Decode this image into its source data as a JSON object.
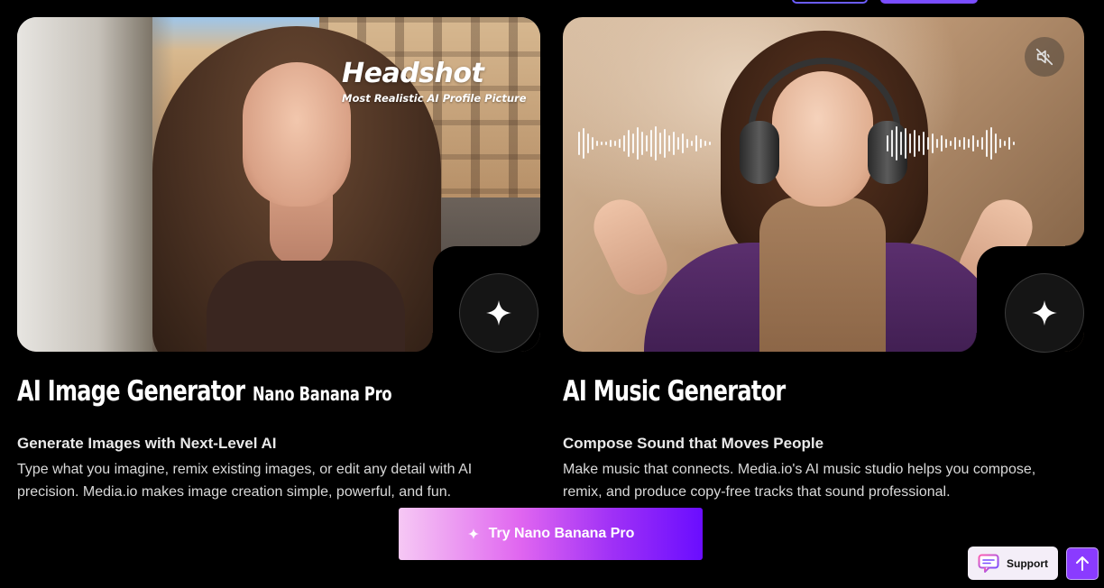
{
  "cards": [
    {
      "overlay_title": "Headshot",
      "overlay_subtitle": "Most Realistic AI Profile Picture",
      "title": "AI Image Generator",
      "title_tag": "Nano Banana Pro",
      "subtitle": "Generate Images with Next-Level AI",
      "description": "Type what you imagine, remix existing images, or edit any detail with AI precision. Media.io makes image creation simple, powerful, and fun."
    },
    {
      "title": "AI Music Generator",
      "subtitle": "Compose Sound that Moves People",
      "description": "Make music that connects. Media.io's AI music studio helps you compose, remix, and produce copy-free tracks that sound professional."
    }
  ],
  "cta": {
    "label": "Try Nano Banana Pro",
    "icon": "sparkle-icon"
  },
  "support": {
    "label": "Support",
    "icon": "chat-icon"
  },
  "scroll_top": {
    "icon": "arrow-up-icon"
  },
  "icons": {
    "sparkle": "sparkle-icon",
    "mute": "speaker-muted-icon"
  },
  "colors": {
    "accent": "#7a4dff",
    "cta_start": "#f6c8f4",
    "cta_end": "#6a0dff",
    "background": "#000000"
  }
}
